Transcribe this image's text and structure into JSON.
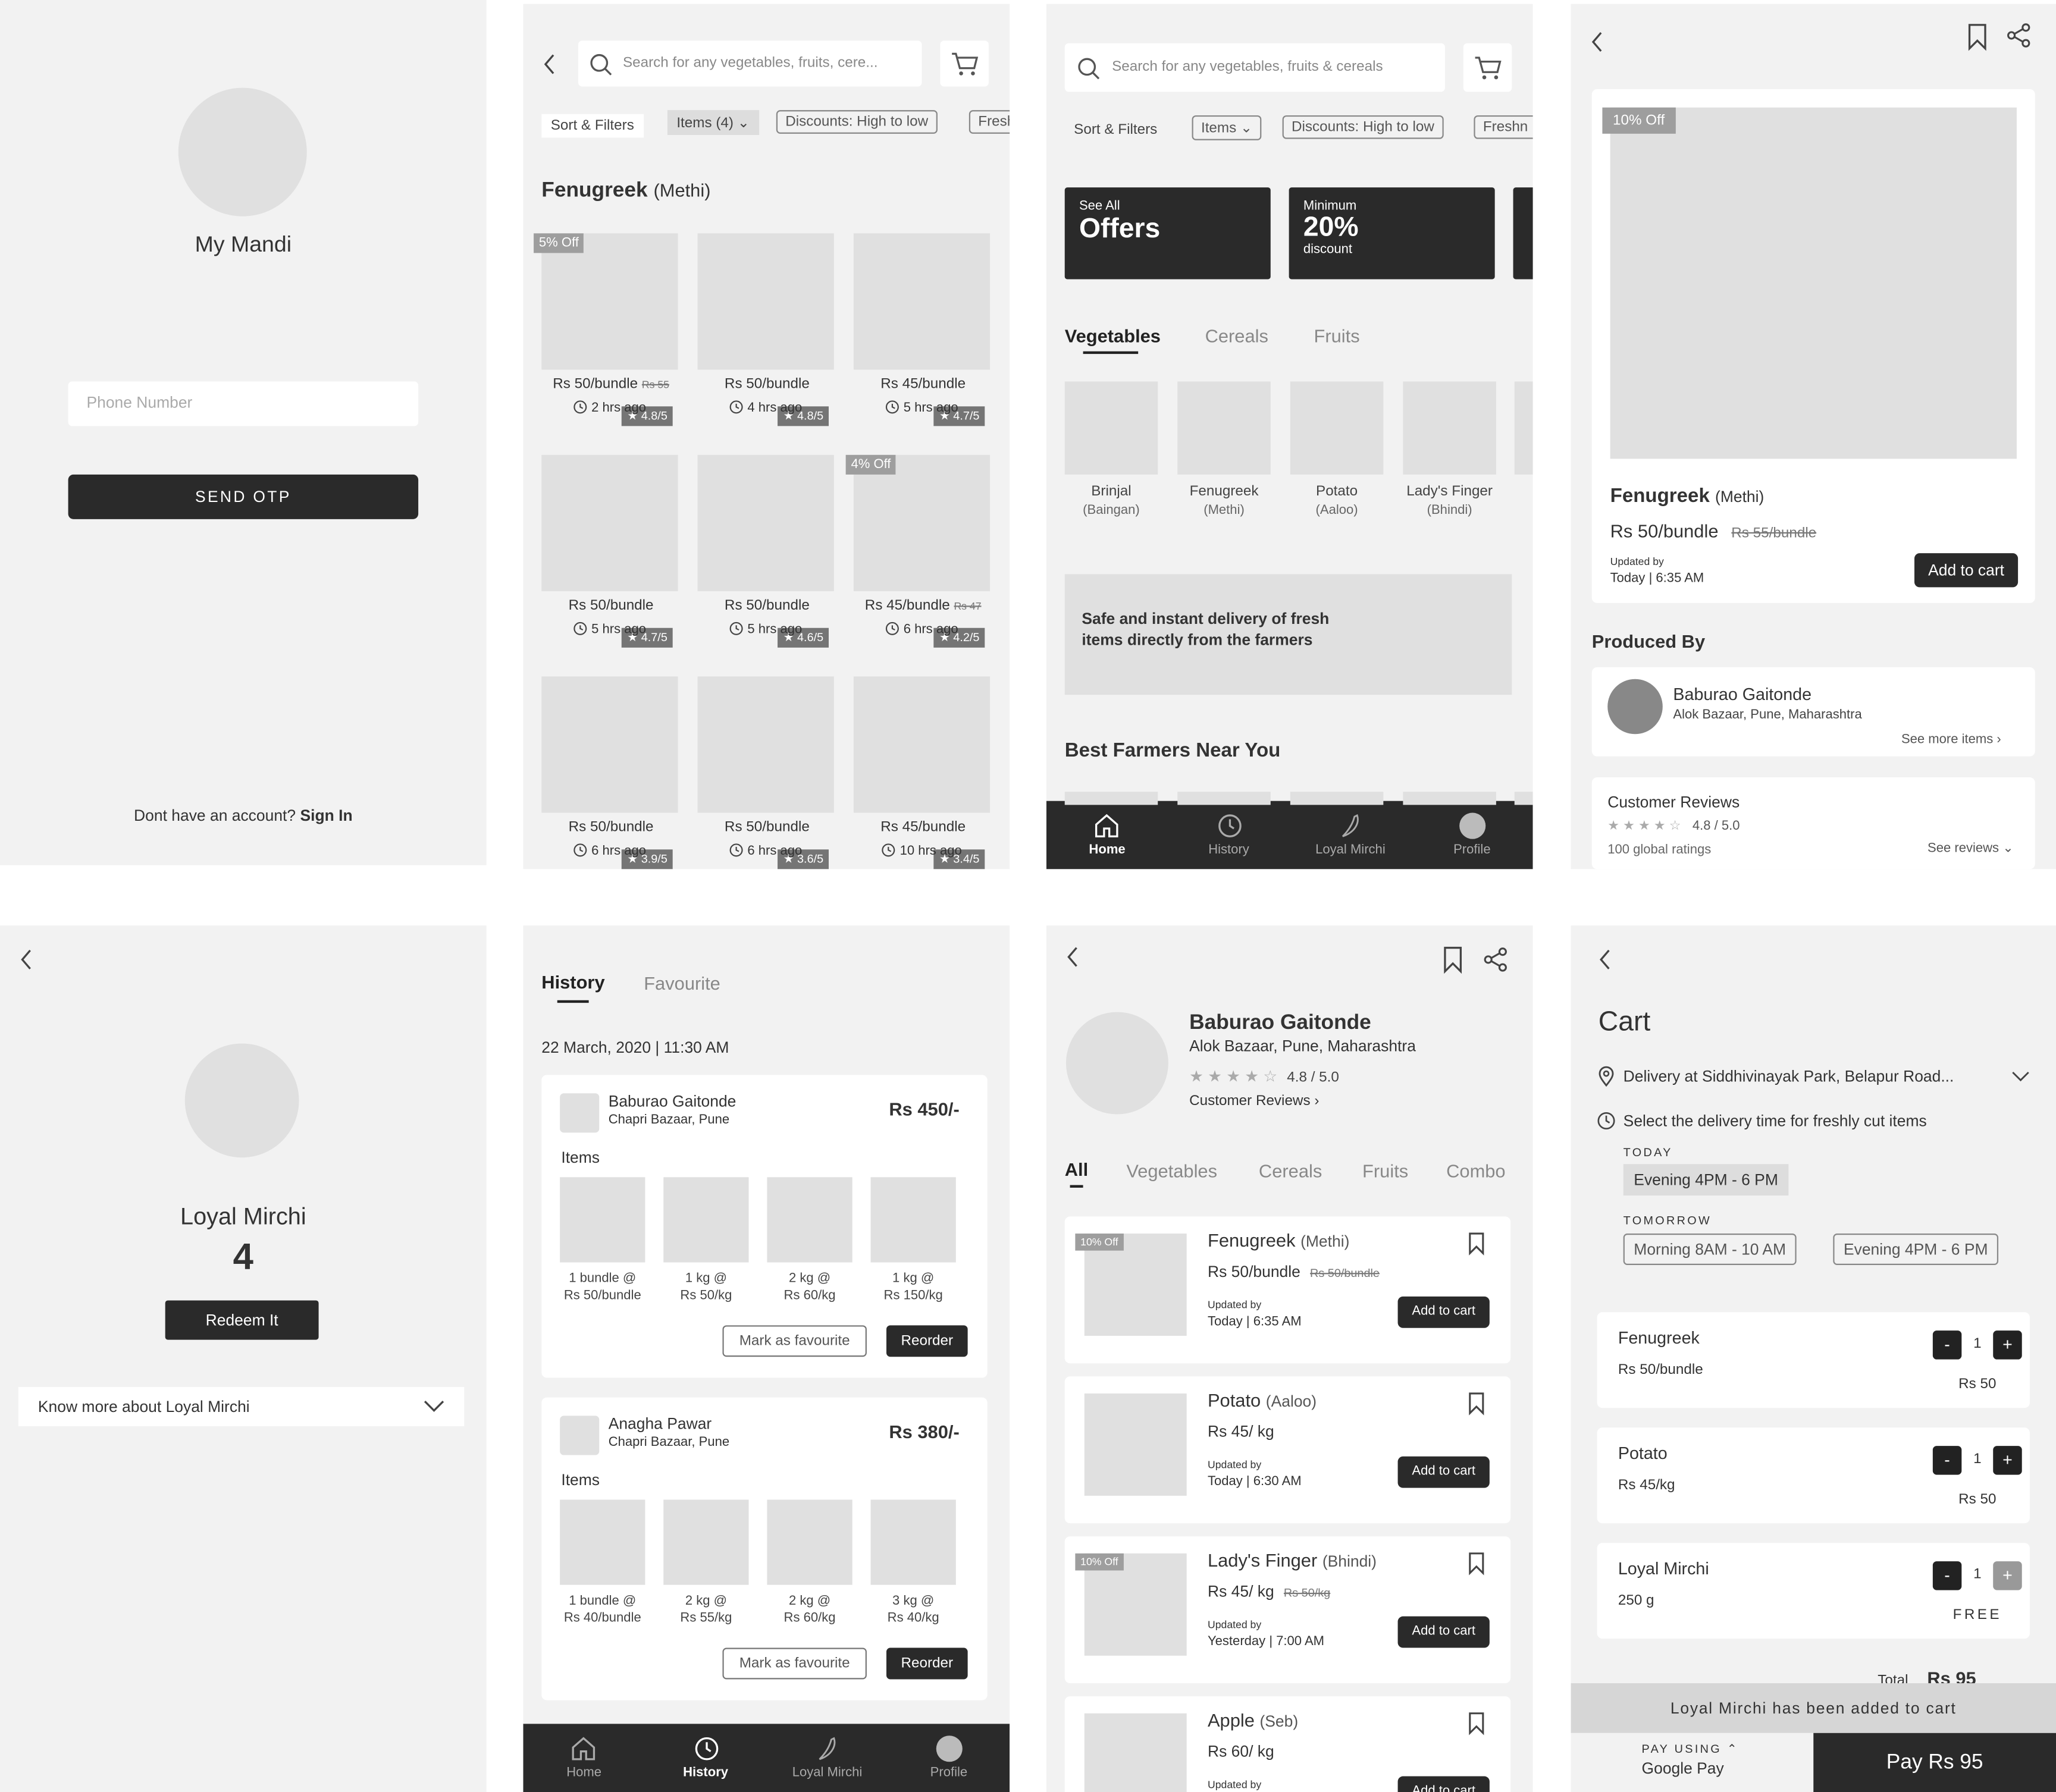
{
  "login": {
    "app_name": "My Mandi",
    "phone_placeholder": "Phone Number",
    "otp_button": "SEND OTP",
    "no_account": "Dont have an account?",
    "sign_in": "Sign In"
  },
  "search": {
    "placeholder": "Search for any vegetables, fruits, cere...",
    "filters": [
      "Sort & Filters",
      "Items (4)",
      "Discounts: High to low",
      "Fresh"
    ],
    "title": "Fenugreek",
    "title_sub": "(Methi)",
    "products": [
      {
        "badge": "5% Off",
        "rating": "4.8/5",
        "price": "Rs 50/bundle",
        "old": "Rs 55",
        "time": "2 hrs ago"
      },
      {
        "badge": "",
        "rating": "4.8/5",
        "price": "Rs 50/bundle",
        "old": "",
        "time": "4 hrs ago"
      },
      {
        "badge": "",
        "rating": "4.7/5",
        "price": "Rs 45/bundle",
        "old": "",
        "time": "5 hrs ago"
      },
      {
        "badge": "",
        "rating": "4.7/5",
        "price": "Rs 50/bundle",
        "old": "",
        "time": "5 hrs ago"
      },
      {
        "badge": "",
        "rating": "4.6/5",
        "price": "Rs 50/bundle",
        "old": "",
        "time": "5 hrs ago"
      },
      {
        "badge": "4% Off",
        "rating": "4.2/5",
        "price": "Rs 45/bundle",
        "old": "Rs 47",
        "time": "6 hrs ago"
      },
      {
        "badge": "",
        "rating": "3.9/5",
        "price": "Rs 50/bundle",
        "old": "",
        "time": "6 hrs ago"
      },
      {
        "badge": "",
        "rating": "3.6/5",
        "price": "Rs 50/bundle",
        "old": "",
        "time": "6 hrs ago"
      },
      {
        "badge": "",
        "rating": "3.4/5",
        "price": "Rs 45/bundle",
        "old": "",
        "time": "10 hrs ago"
      }
    ]
  },
  "home": {
    "placeholder": "Search for any vegetables, fruits & cereals",
    "filters": [
      "Sort & Filters",
      "Items",
      "Discounts: High to low",
      "Freshn"
    ],
    "offer1_small": "See All",
    "offer1_big": "Offers",
    "offer2_small": "Minimum",
    "offer2_big": "20%",
    "offer2_sub": "discount",
    "tabs": [
      "Vegetables",
      "Cereals",
      "Fruits"
    ],
    "veg": [
      {
        "name": "Brinjal",
        "sub": "(Baingan)"
      },
      {
        "name": "Fenugreek",
        "sub": "(Methi)"
      },
      {
        "name": "Potato",
        "sub": "(Aaloo)"
      },
      {
        "name": "Lady's Finger",
        "sub": "(Bhindi)"
      }
    ],
    "banner": "Safe and instant delivery of fresh items directly from the farmers",
    "farmers_title": "Best Farmers Near You",
    "nav": [
      "Home",
      "History",
      "Loyal Mirchi",
      "Profile"
    ]
  },
  "detail": {
    "badge": "10% Off",
    "name": "Fenugreek",
    "name_sub": "(Methi)",
    "price": "Rs 50/bundle",
    "old": "Rs 55/bundle",
    "updated_by": "Updated by",
    "updated": "Today | 6:35 AM",
    "add": "Add to cart",
    "produced_by": "Produced By",
    "farmer": "Baburao Gaitonde",
    "location": "Alok Bazaar, Pune, Maharashtra",
    "see_more": "See more items",
    "reviews_title": "Customer Reviews",
    "rating": "4.8 / 5.0",
    "ratings_count": "100 global ratings",
    "see_reviews": "See reviews"
  },
  "loyal": {
    "title": "Loyal Mirchi",
    "points": "4",
    "redeem": "Redeem It",
    "know_more": "Know more about Loyal Mirchi"
  },
  "history": {
    "tabs": [
      "History",
      "Favourite"
    ],
    "date": "22 March, 2020 | 11:30 AM",
    "items_label": "Items",
    "fav_btn": "Mark as favourite",
    "reorder": "Reorder",
    "orders": [
      {
        "farmer": "Baburao Gaitonde",
        "place": "Chapri Bazaar, Pune",
        "total": "Rs 450/-",
        "items": [
          [
            "1 bundle @",
            "Rs 50/bundle"
          ],
          [
            "1 kg @",
            "Rs 50/kg"
          ],
          [
            "2 kg @",
            "Rs 60/kg"
          ],
          [
            "1 kg @",
            "Rs 150/kg"
          ]
        ]
      },
      {
        "farmer": "Anagha Pawar",
        "place": "Chapri Bazaar, Pune",
        "total": "Rs 380/-",
        "items": [
          [
            "1 bundle @",
            "Rs 40/bundle"
          ],
          [
            "2 kg @",
            "Rs 55/kg"
          ],
          [
            "2 kg @",
            "Rs 60/kg"
          ],
          [
            "3 kg @",
            "Rs 40/kg"
          ]
        ]
      }
    ],
    "nav": [
      "Home",
      "History",
      "Loyal Mirchi",
      "Profile"
    ]
  },
  "farmer": {
    "name": "Baburao Gaitonde",
    "location": "Alok Bazaar, Pune, Maharashtra",
    "rating": "4.8 / 5.0",
    "reviews": "Customer Reviews",
    "tabs": [
      "All",
      "Vegetables",
      "Cereals",
      "Fruits",
      "Combo"
    ],
    "updated_by": "Updated by",
    "add": "Add to cart",
    "items": [
      {
        "badge": "10% Off",
        "name": "Fenugreek",
        "sub": "(Methi)",
        "price": "Rs 50/bundle",
        "old": "Rs 50/bundle",
        "updated": "Today | 6:35 AM"
      },
      {
        "badge": "",
        "name": "Potato",
        "sub": "(Aaloo)",
        "price": "Rs 45/ kg",
        "old": "",
        "updated": "Today | 6:30 AM"
      },
      {
        "badge": "10% Off",
        "name": "Lady's Finger",
        "sub": "(Bhindi)",
        "price": "Rs 45/ kg",
        "old": "Rs 50/kg",
        "updated": "Yesterday | 7:00 AM"
      },
      {
        "badge": "",
        "name": "Apple",
        "sub": "(Seb)",
        "price": "Rs 60/ kg",
        "old": "",
        "updated": ""
      }
    ]
  },
  "cart": {
    "title": "Cart",
    "delivery": "Delivery at Siddhivinayak Park, Belapur Road...",
    "select_time": "Select the delivery time for freshly cut items",
    "today": "TODAY",
    "today_slot": "Evening 4PM - 6 PM",
    "tomorrow": "TOMORROW",
    "tom_slot1": "Morning 8AM - 10 AM",
    "tom_slot2": "Evening 4PM - 6 PM",
    "items": [
      {
        "name": "Fenugreek",
        "unit": "Rs 50/bundle",
        "qty": "1",
        "price": "Rs 50"
      },
      {
        "name": "Potato",
        "unit": "Rs 45/kg",
        "qty": "1",
        "price": "Rs 50"
      },
      {
        "name": "Loyal Mirchi",
        "unit": "250 g",
        "qty": "1",
        "price": "FREE"
      }
    ],
    "total_label": "Total",
    "total": "Rs 95",
    "toast": "Loyal Mirchi has been added to cart",
    "pay_using": "PAY USING",
    "pay_method": "Google Pay",
    "pay_btn": "Pay Rs 95"
  }
}
